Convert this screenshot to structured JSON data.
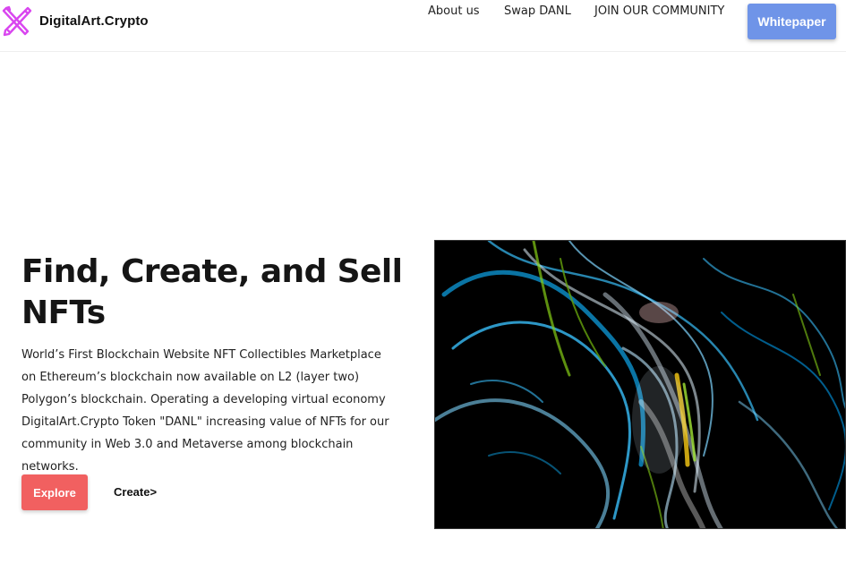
{
  "header": {
    "brand_name": "DigitalArt.Crypto",
    "logo_icon": "crossed-pencil-brush-icon",
    "logo_color": "#d946ef",
    "nav": {
      "about": "About us",
      "swap": "Swap DANL",
      "community": "JOIN OUR COMMUNITY"
    },
    "whitepaper_label": "Whitepaper",
    "whitepaper_color": "#6f94e8"
  },
  "hero": {
    "title": "Find, Create, and Sell NFTs",
    "description": "World’s First Blockchain Website NFT Collectibles Marketplace on Ethereum’s blockchain now available on L2 (layer two) Polygon’s blockchain. Operating a developing virtual economy DigitalArt.Crypto Token \"DANL\" increasing value of NFTs for our community in Web 3.0 and Metaverse among blockchain networks.",
    "explore_label": "Explore",
    "explore_color": "#f16060",
    "create_label": "Create>"
  },
  "artwork": {
    "palette": [
      "#000000",
      "#38bdf8",
      "#7dd3fc",
      "#e0f2fe",
      "#84cc16",
      "#facc15"
    ]
  }
}
